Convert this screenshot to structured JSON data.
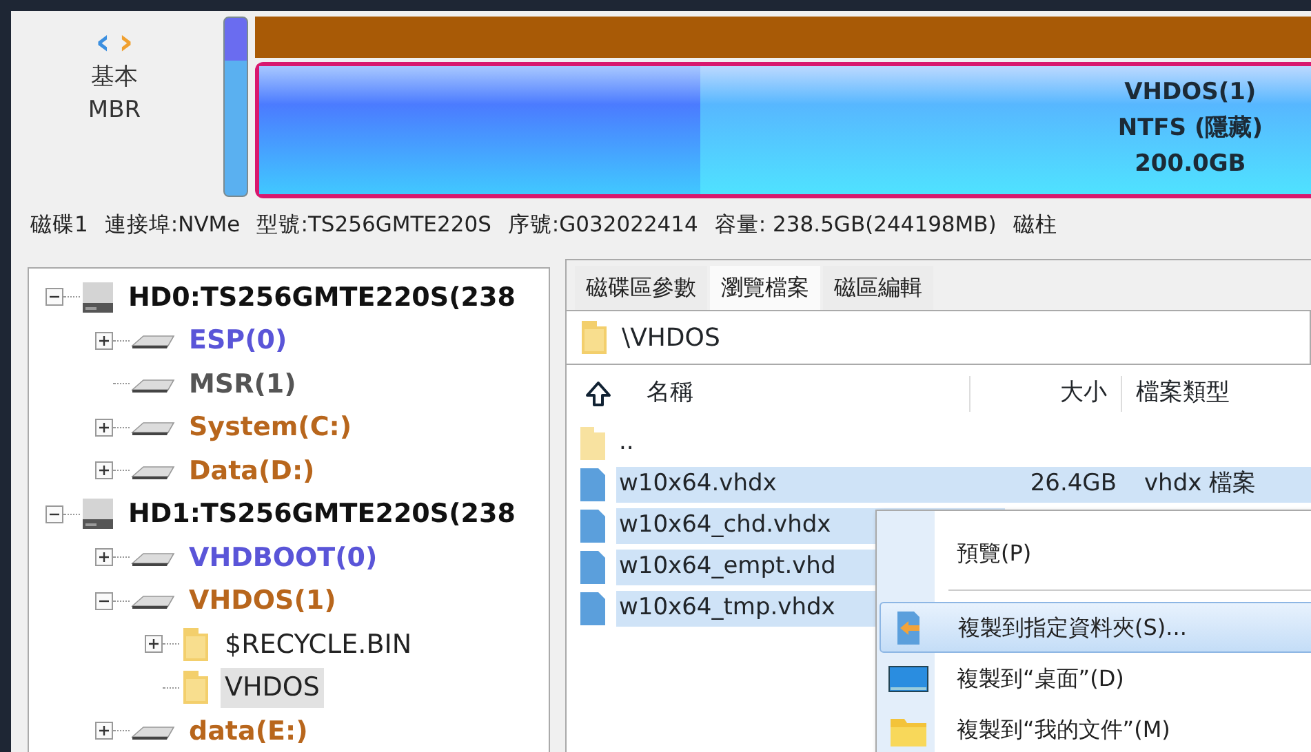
{
  "disk_map": {
    "nav": [
      "‹",
      "›"
    ],
    "disk_type": [
      "基本",
      "MBR"
    ],
    "partition": {
      "lines": [
        "VHDOS(1)",
        "NTFS (隱藏)",
        "200.0GB"
      ]
    }
  },
  "disk_info": [
    "磁碟1",
    "連接埠:NVMe",
    "型號:TS256GMTE220S",
    "序號:G032022414",
    "容量: 238.5GB(244198MB)",
    "磁柱"
  ],
  "tree": [
    {
      "kind": "disk",
      "label": "HD0:TS256GMTE220S(238",
      "expanded": true,
      "selected": false,
      "children": [
        {
          "kind": "partition",
          "label": "ESP(0)",
          "color": "#5a55d8",
          "expanded": false,
          "selected": false
        },
        {
          "kind": "partition",
          "label": "MSR(1)",
          "color": "#555555",
          "selected": false
        },
        {
          "kind": "partition",
          "label": "System(C:)",
          "color": "#b8661c",
          "expanded": false,
          "selected": false
        },
        {
          "kind": "partition",
          "label": "Data(D:)",
          "color": "#b8661c",
          "expanded": false,
          "selected": false
        }
      ]
    },
    {
      "kind": "disk",
      "label": "HD1:TS256GMTE220S(238",
      "expanded": true,
      "selected": false,
      "children": [
        {
          "kind": "partition",
          "label": "VHDBOOT(0)",
          "color": "#5a55d8",
          "expanded": false,
          "selected": false
        },
        {
          "kind": "partition",
          "label": "VHDOS(1)",
          "color": "#b8661c",
          "expanded": true,
          "selected": false,
          "children": [
            {
              "kind": "folder",
              "label": "$RECYCLE.BIN",
              "expanded": false,
              "selected": false
            },
            {
              "kind": "folder",
              "label": "VHDOS",
              "selected": true
            }
          ]
        },
        {
          "kind": "partition",
          "label": "data(E:)",
          "color": "#b8661c",
          "expanded": false,
          "selected": false
        }
      ]
    }
  ],
  "tabs": [
    {
      "label": "磁碟區參數",
      "selected": false
    },
    {
      "label": "瀏覽檔案",
      "selected": true
    },
    {
      "label": "磁區編輯",
      "selected": false
    }
  ],
  "path": "\\VHDOS",
  "table": {
    "columns": [
      "名稱",
      "大小",
      "檔案類型"
    ],
    "rows": [
      {
        "kind": "folder",
        "name": "..",
        "selected": false
      },
      {
        "kind": "file",
        "name": "w10x64.vhdx",
        "size": "26.4GB",
        "type": "vhdx 檔案",
        "selected": true
      },
      {
        "kind": "file",
        "name": "w10x64_chd.vhdx",
        "selected": true
      },
      {
        "kind": "file",
        "name": "w10x64_empt.vhd",
        "selected": true
      },
      {
        "kind": "file",
        "name": "w10x64_tmp.vhdx",
        "selected": true
      }
    ]
  },
  "context_menu": [
    {
      "kind": "plain",
      "label": "預覽(P)",
      "selected": false
    },
    {
      "kind": "separator"
    },
    {
      "kind": "copy",
      "label": "複製到指定資料夾(S)...",
      "selected": true
    },
    {
      "kind": "desktop",
      "label": "複製到“桌面”(D)",
      "selected": false
    },
    {
      "kind": "documents",
      "label": "複製到“我的文件”(M)",
      "selected": false
    }
  ]
}
